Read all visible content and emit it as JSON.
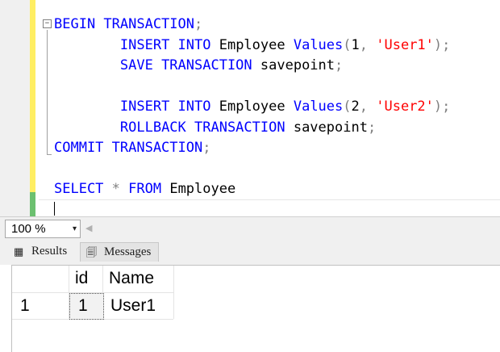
{
  "editor": {
    "collapse_glyph": "−",
    "lines": [
      {
        "parts": [
          {
            "t": "BEGIN TRANSACTION",
            "c": "kw"
          },
          {
            "t": ";",
            "c": "pun"
          }
        ]
      },
      {
        "parts": [
          {
            "t": "        "
          },
          {
            "t": "INSERT INTO",
            "c": "kw"
          },
          {
            "t": " Employee "
          },
          {
            "t": "Values",
            "c": "kw"
          },
          {
            "t": "(",
            "c": "pun"
          },
          {
            "t": "1"
          },
          {
            "t": ", ",
            "c": "pun"
          },
          {
            "t": "'User1'",
            "c": "str"
          },
          {
            "t": ");",
            "c": "pun"
          }
        ]
      },
      {
        "parts": [
          {
            "t": "        "
          },
          {
            "t": "SAVE TRANSACTION",
            "c": "kw"
          },
          {
            "t": " savepoint"
          },
          {
            "t": ";",
            "c": "pun"
          }
        ]
      },
      {
        "parts": [
          {
            "t": ""
          }
        ]
      },
      {
        "parts": [
          {
            "t": "        "
          },
          {
            "t": "INSERT INTO",
            "c": "kw"
          },
          {
            "t": " Employee "
          },
          {
            "t": "Values",
            "c": "kw"
          },
          {
            "t": "(",
            "c": "pun"
          },
          {
            "t": "2"
          },
          {
            "t": ", ",
            "c": "pun"
          },
          {
            "t": "'User2'",
            "c": "str"
          },
          {
            "t": ");",
            "c": "pun"
          }
        ]
      },
      {
        "parts": [
          {
            "t": "        "
          },
          {
            "t": "ROLLBACK TRANSACTION",
            "c": "kw"
          },
          {
            "t": " savepoint"
          },
          {
            "t": ";",
            "c": "pun"
          }
        ]
      },
      {
        "parts": [
          {
            "t": "COMMIT TRANSACTION",
            "c": "kw"
          },
          {
            "t": ";",
            "c": "pun"
          }
        ]
      },
      {
        "parts": [
          {
            "t": ""
          }
        ]
      },
      {
        "parts": [
          {
            "t": "SELECT",
            "c": "kw"
          },
          {
            "t": " * ",
            "c": "pun"
          },
          {
            "t": "FROM",
            "c": "kw"
          },
          {
            "t": " Employee"
          }
        ]
      }
    ]
  },
  "zoom": {
    "value": "100 %",
    "arrow": "▾",
    "scroll_left": "◀"
  },
  "tabs": {
    "results": {
      "label": "Results",
      "icon": "▦"
    },
    "messages": {
      "label": "Messages",
      "icon": "🗐"
    }
  },
  "grid": {
    "columns": [
      "id",
      "Name"
    ],
    "rows": [
      {
        "row_number": "1",
        "id": "1",
        "name": "User1"
      }
    ]
  }
}
